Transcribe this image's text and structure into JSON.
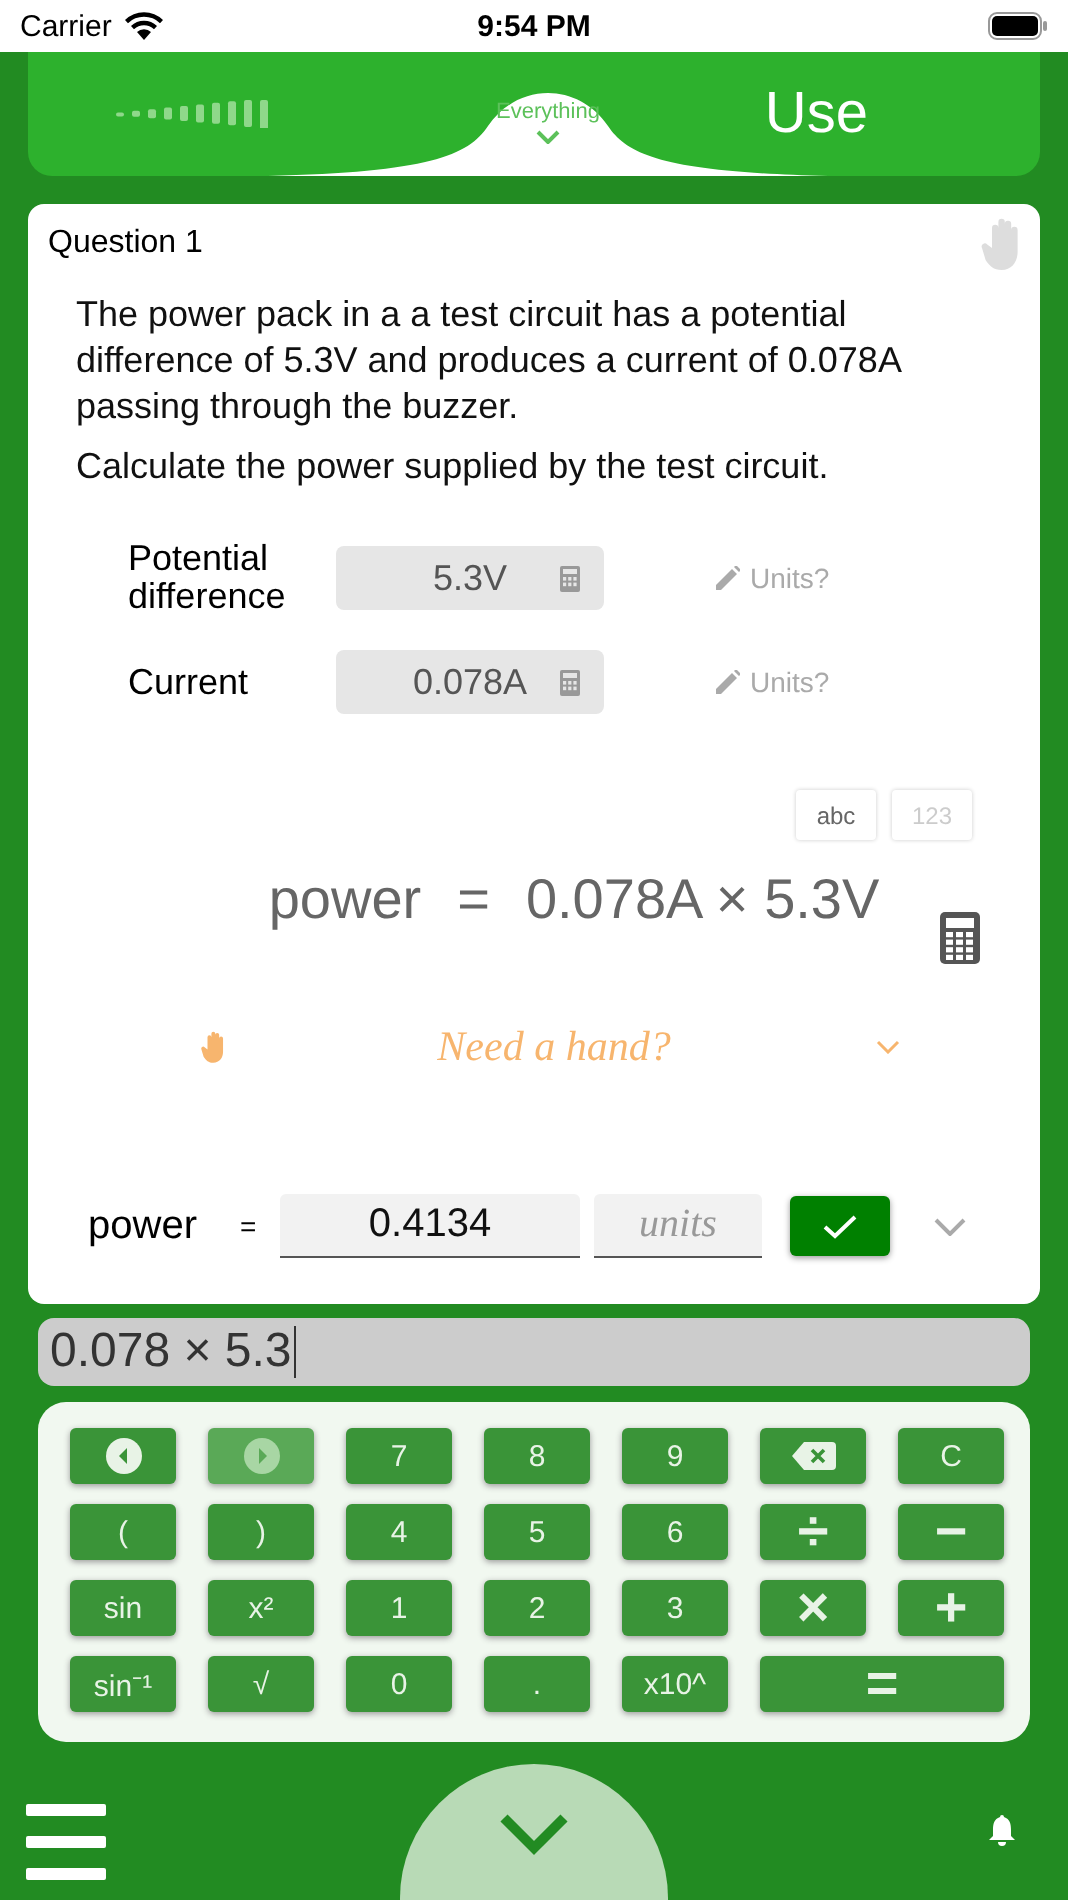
{
  "status_bar": {
    "carrier": "Carrier",
    "time": "9:54 PM"
  },
  "header": {
    "filter": "Everything",
    "title": "Use"
  },
  "question": {
    "title": "Question 1",
    "paragraphs": [
      "The power pack in a a test circuit has a potential difference of 5.3V and produces a current of 0.078A passing through the buzzer.",
      "Calculate the power supplied by the test circuit."
    ],
    "givens": [
      {
        "label": "Potential difference",
        "value": "5.3V",
        "units": "Units?"
      },
      {
        "label": "Current",
        "value": "0.078A",
        "units": "Units?"
      }
    ],
    "modes": [
      {
        "label": "abc",
        "selected": true
      },
      {
        "label": "123",
        "selected": false
      }
    ],
    "equation": {
      "lhs": "power",
      "eq": "=",
      "rhs": "0.078A × 5.3V"
    },
    "hint": "Need a hand?",
    "answer": {
      "label": "power",
      "eq": "=",
      "value": "0.4134",
      "units_placeholder": "units"
    }
  },
  "expression": "0.078 × 5.3",
  "keypad": [
    {
      "kind": "left"
    },
    {
      "kind": "right",
      "disabled": true
    },
    {
      "kind": "text",
      "label": "7"
    },
    {
      "kind": "text",
      "label": "8"
    },
    {
      "kind": "text",
      "label": "9"
    },
    {
      "kind": "backspace"
    },
    {
      "kind": "text",
      "label": "C"
    },
    {
      "kind": "text",
      "label": "("
    },
    {
      "kind": "text",
      "label": ")"
    },
    {
      "kind": "text",
      "label": "4"
    },
    {
      "kind": "text",
      "label": "5"
    },
    {
      "kind": "text",
      "label": "6"
    },
    {
      "kind": "symbol",
      "label": "÷"
    },
    {
      "kind": "symbol",
      "label": "−"
    },
    {
      "kind": "text",
      "label": "sin"
    },
    {
      "kind": "text",
      "label": "x²"
    },
    {
      "kind": "text",
      "label": "1"
    },
    {
      "kind": "text",
      "label": "2"
    },
    {
      "kind": "text",
      "label": "3"
    },
    {
      "kind": "symbol",
      "label": "×"
    },
    {
      "kind": "symbol",
      "label": "+"
    },
    {
      "kind": "text",
      "label": "sin⁻¹"
    },
    {
      "kind": "text",
      "label": "√"
    },
    {
      "kind": "text",
      "label": "0"
    },
    {
      "kind": "text",
      "label": "."
    },
    {
      "kind": "text",
      "label": "x10^"
    },
    {
      "kind": "wide",
      "label": "="
    }
  ]
}
